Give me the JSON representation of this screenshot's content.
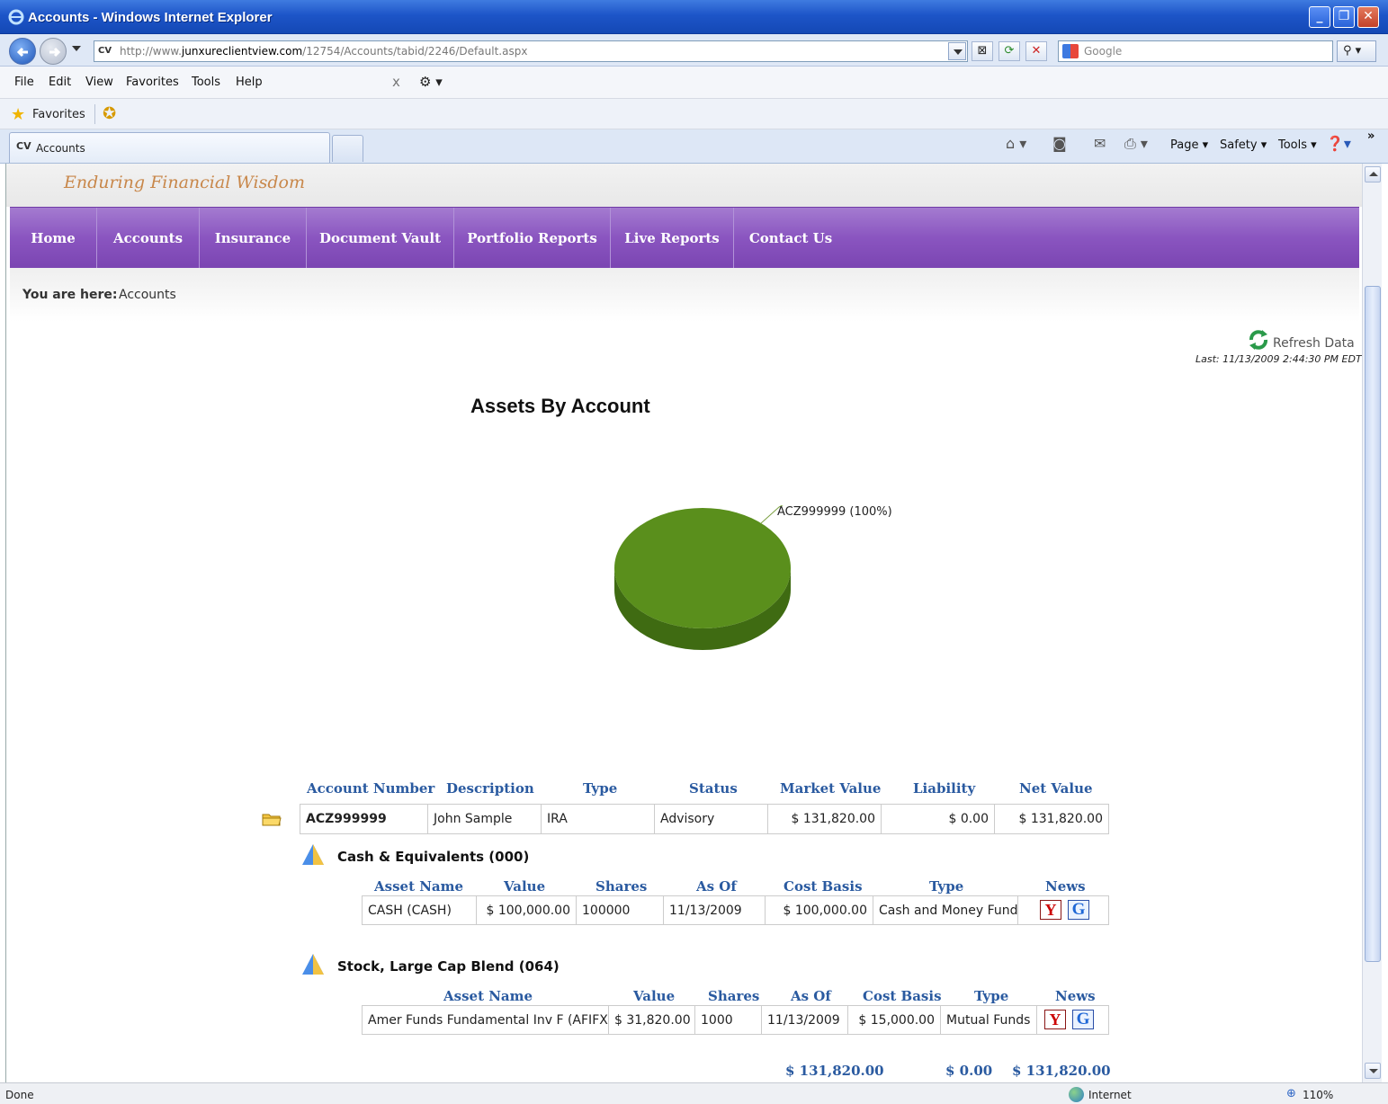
{
  "window": {
    "title": "Accounts - Windows Internet Explorer",
    "min": "_",
    "max": "❐",
    "close": "✕"
  },
  "address": {
    "url_prefix": "http://www.",
    "url_host": "junxureclientview.com",
    "url_path": "/12754/Accounts/tabid/2246/Default.aspx",
    "favicon": "CV",
    "search_placeholder": "Google",
    "search_icon": "⚲"
  },
  "menubar": {
    "items": [
      "File",
      "Edit",
      "View",
      "Favorites",
      "Tools",
      "Help"
    ],
    "close_x": "x"
  },
  "favorites": {
    "label": "Favorites"
  },
  "tab": {
    "favicon": "CV",
    "label": "Accounts"
  },
  "commandbar": {
    "page": "Page",
    "safety": "Safety",
    "tools": "Tools",
    "more": "»"
  },
  "site": {
    "tagline": "Enduring Financial Wisdom",
    "nav": [
      "Home",
      "Accounts",
      "Insurance",
      "Document Vault",
      "Portfolio Reports",
      "Live Reports",
      "Contact Us"
    ],
    "breadcrumb_label": "You are here:",
    "breadcrumb_value": "Accounts",
    "refresh_label": "Refresh Data",
    "last_updated": "Last: 11/13/2009 2:44:30 PM EDT"
  },
  "chart_data": {
    "type": "pie",
    "title": "Assets By Account",
    "categories": [
      "ACZ999999"
    ],
    "values": [
      100
    ],
    "labels": [
      "ACZ999999 (100%)"
    ],
    "colors": [
      "#5a8f1c"
    ]
  },
  "accounts": {
    "headers": [
      "Account Number",
      "Description",
      "Type",
      "Status",
      "Market Value",
      "Liability",
      "Net Value"
    ],
    "rows": [
      [
        "ACZ999999",
        "John Sample",
        "IRA",
        "Advisory",
        "$ 131,820.00",
        "$ 0.00",
        "$ 131,820.00"
      ]
    ],
    "sections": [
      {
        "title": "Cash & Equivalents (000)",
        "headers": [
          "Asset Name",
          "Value",
          "Shares",
          "As Of",
          "Cost Basis",
          "Type",
          "News"
        ],
        "rows": [
          [
            "CASH (CASH)",
            "$ 100,000.00",
            "100000",
            "11/13/2009",
            "$ 100,000.00",
            "Cash and Money Funds"
          ]
        ]
      },
      {
        "title": "Stock, Large Cap Blend (064)",
        "headers": [
          "Asset Name",
          "Value",
          "Shares",
          "As Of",
          "Cost Basis",
          "Type",
          "News"
        ],
        "rows": [
          [
            "Amer Funds Fundamental Inv F (AFIFX)",
            "$ 31,820.00",
            "1000",
            "11/13/2009",
            "$ 15,000.00",
            "Mutual Funds"
          ]
        ]
      }
    ],
    "totals": {
      "market_value": "$ 131,820.00",
      "liability": "$ 0.00",
      "net_value": "$ 131,820.00"
    },
    "news_yahoo": "Y",
    "news_google": "G"
  },
  "status": {
    "left": "Done",
    "zone": "Internet",
    "zoom": "110%"
  },
  "colors": {
    "nav_purple": "#8a55c0",
    "header_blue": "#2a5aa0",
    "pie_green": "#5a8f1c"
  }
}
